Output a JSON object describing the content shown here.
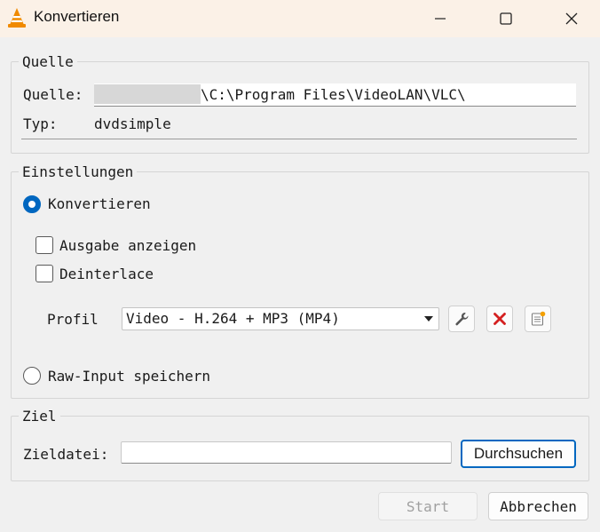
{
  "window": {
    "title": "Konvertieren",
    "controls": [
      "minimize",
      "maximize",
      "close"
    ]
  },
  "source_group": {
    "title": "Quelle",
    "source_label": "Quelle:",
    "source_value": "\\C:\\Program Files\\VideoLAN\\VLC\\",
    "type_label": "Typ:",
    "type_value": "dvdsimple"
  },
  "settings_group": {
    "title": "Einstellungen",
    "convert_radio": {
      "label": "Konvertieren",
      "checked": true
    },
    "show_output": {
      "label": "Ausgabe anzeigen",
      "checked": false
    },
    "deinterlace": {
      "label": "Deinterlace",
      "checked": false
    },
    "profile_label": "Profil",
    "profile_value": "Video - H.264 + MP3 (MP4)",
    "profile_tools": [
      "wrench-icon",
      "delete-icon",
      "new-profile-icon"
    ],
    "raw_radio": {
      "label": "Raw-Input speichern",
      "checked": false
    }
  },
  "dest_group": {
    "title": "Ziel",
    "dest_label": "Zieldatei:",
    "dest_value": "",
    "browse_label": "Durchsuchen"
  },
  "footer": {
    "start_label": "Start",
    "start_enabled": false,
    "cancel_label": "Abbrechen"
  },
  "colors": {
    "titlebar": "#fbf1e7",
    "accent": "#0067c0",
    "delete_red": "#d42020"
  }
}
